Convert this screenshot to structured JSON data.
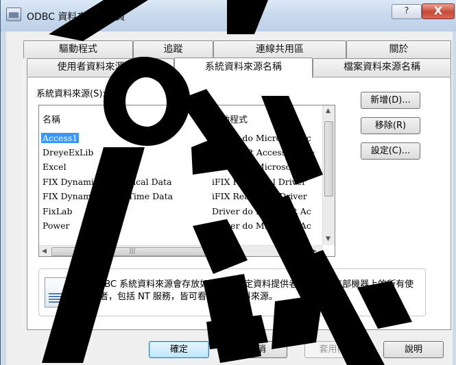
{
  "window": {
    "title": "ODBC 資料來源管理員",
    "help_label": "?",
    "close_label": "X"
  },
  "tabs": {
    "back_row": [
      "驅動程式",
      "追蹤",
      "連線共用區",
      "關於"
    ],
    "front_row": [
      "使用者資料來源名稱",
      "系統資料來源名稱",
      "檔案資料來源名稱"
    ],
    "active": "系統資料來源名稱"
  },
  "panel": {
    "group_label": "系統資料來源(S):",
    "columns": [
      "名稱",
      "驅動程式"
    ],
    "rows": [
      {
        "name": "Access1",
        "driver": "Driver do Microsoft Ac",
        "selected": true
      },
      {
        "name": "DreyeExLib",
        "driver": "Microsoft Access Drive:"
      },
      {
        "name": "Excel",
        "driver": "Driver do Microsoft Ex"
      },
      {
        "name": "FIX Dynamics Historical Data",
        "driver": "iFIX Historical Driver"
      },
      {
        "name": "FIX Dynamics Real Time Data",
        "driver": "iFIX Real Time Driver"
      },
      {
        "name": "FixLab",
        "driver": "Driver do Microsoft Ac"
      },
      {
        "name": "Power",
        "driver": "Driver do Microsoft Ac"
      }
    ],
    "side_buttons": {
      "add": "新增(D)...",
      "remove": "移除(R)",
      "configure": "設定(C)..."
    },
    "info_text": "ODBC 系統資料來源會存放如何連線特定資料提供者的資訊。這部機器上的所有使用者，包括 NT 服務，皆可看到系統資料來源。"
  },
  "buttons": {
    "ok": "確定",
    "cancel": "取消",
    "apply": "套用(A)",
    "help": "說明"
  },
  "colors": {
    "selection": "#3399ff",
    "watermark": "#000000"
  }
}
